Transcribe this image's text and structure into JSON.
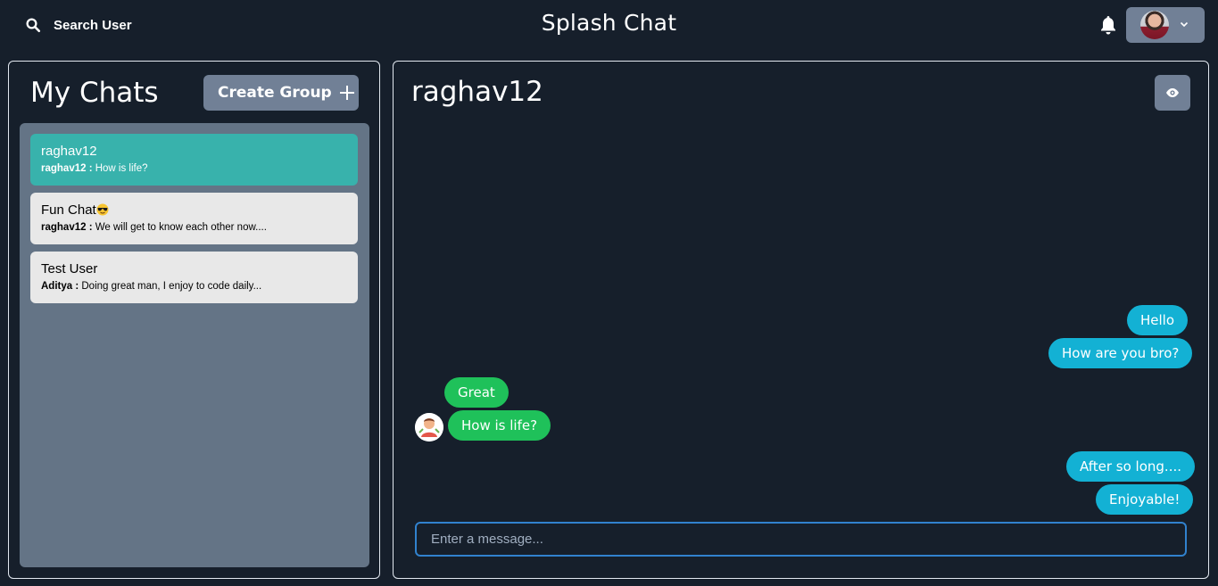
{
  "header": {
    "search_label": "Search User",
    "app_title": "Splash Chat"
  },
  "my_chats": {
    "title": "My Chats",
    "create_group_label": "Create Group",
    "chats": [
      {
        "name": "raghav12",
        "latest_sender": "raghav12 :",
        "latest_message": "How is life?",
        "active": true
      },
      {
        "name": "Fun Chat",
        "latest_sender": "raghav12 :",
        "latest_message": "We will get to know each other now....",
        "active": false,
        "emoji": "smiling-face-with-sunglasses"
      },
      {
        "name": "Test User",
        "latest_sender": "Aditya :",
        "latest_message": "Doing great man, I enjoy to code daily...",
        "active": false
      }
    ]
  },
  "conversation": {
    "title": "raghav12",
    "messages": [
      {
        "text": "Hello",
        "mine": true
      },
      {
        "text": "How are you bro?",
        "mine": true
      },
      {
        "text": "Great",
        "mine": false
      },
      {
        "text": "How is life?",
        "mine": false
      },
      {
        "text": "After so long....",
        "mine": true
      },
      {
        "text": "Enjoyable!",
        "mine": true
      }
    ],
    "input_placeholder": "Enter a message...",
    "input_value": ""
  },
  "colors": {
    "background": "#161f2b",
    "active_chat": "#38b2ac",
    "chat_list_bg": "#647486",
    "button_gray": "#718096",
    "my_bubble": "#13b1d4",
    "their_bubble": "#1fc15a",
    "input_border": "#3182ce"
  },
  "icons": {
    "search": "search-icon",
    "notifications": "bell-icon",
    "menu_chevron": "chevron-down-icon",
    "add": "plus-icon",
    "view_profile": "eye-icon"
  }
}
